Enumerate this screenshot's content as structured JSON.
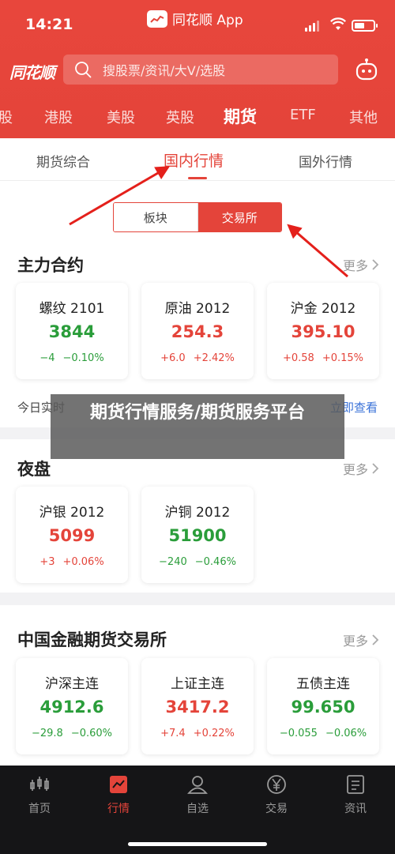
{
  "status": {
    "time": "14:21",
    "app_name": "同花顺 App"
  },
  "header": {
    "logo": "同花顺",
    "search_placeholder": "搜股票/资讯/大V/选股",
    "market_tabs": [
      "股",
      "港股",
      "美股",
      "英股",
      "期货",
      "ETF",
      "其他"
    ],
    "active_market_tab": "期货"
  },
  "sub_tabs": [
    "期货综合",
    "国内行情",
    "国外行情"
  ],
  "active_sub_tab": "国内行情",
  "segment": [
    "板块",
    "交易所"
  ],
  "active_segment": "交易所",
  "sections": [
    {
      "title": "主力合约",
      "more": "更多",
      "cards": [
        {
          "name": "螺纹 2101",
          "price": "3844",
          "change": "−4",
          "pct": "−0.10%",
          "dir": "down"
        },
        {
          "name": "原油 2012",
          "price": "254.3",
          "change": "+6.0",
          "pct": "+2.42%",
          "dir": "up"
        },
        {
          "name": "沪金 2012",
          "price": "395.10",
          "change": "+0.58",
          "pct": "+0.15%",
          "dir": "up"
        }
      ]
    },
    {
      "title": "夜盘",
      "more": "更多",
      "cards": [
        {
          "name": "沪银 2012",
          "price": "5099",
          "change": "+3",
          "pct": "+0.06%",
          "dir": "up"
        },
        {
          "name": "沪铜 2012",
          "price": "51900",
          "change": "−240",
          "pct": "−0.46%",
          "dir": "down"
        }
      ]
    },
    {
      "title": "中国金融期货交易所",
      "more": "更多",
      "cards": [
        {
          "name": "沪深主连",
          "price": "4912.6",
          "change": "−29.8",
          "pct": "−0.60%",
          "dir": "down"
        },
        {
          "name": "上证主连",
          "price": "3417.2",
          "change": "+7.4",
          "pct": "+0.22%",
          "dir": "up"
        },
        {
          "name": "五债主连",
          "price": "99.650",
          "change": "−0.055",
          "pct": "−0.06%",
          "dir": "down"
        }
      ]
    }
  ],
  "hint": {
    "text": "今日实时",
    "link": "立即查看"
  },
  "overlay_text": "期货行情服务/期货服务平台",
  "bottom_nav": [
    "首页",
    "行情",
    "自选",
    "交易",
    "资讯"
  ],
  "active_nav": "行情",
  "colors": {
    "brand_red": "#e4443a",
    "down_green": "#2a9d3a",
    "link_blue": "#3a72d8"
  },
  "icons": [
    "search-icon",
    "robot-icon",
    "chevron-right-icon",
    "home-chart-icon",
    "market-chart-icon",
    "user-icon",
    "yen-icon",
    "news-icon"
  ]
}
